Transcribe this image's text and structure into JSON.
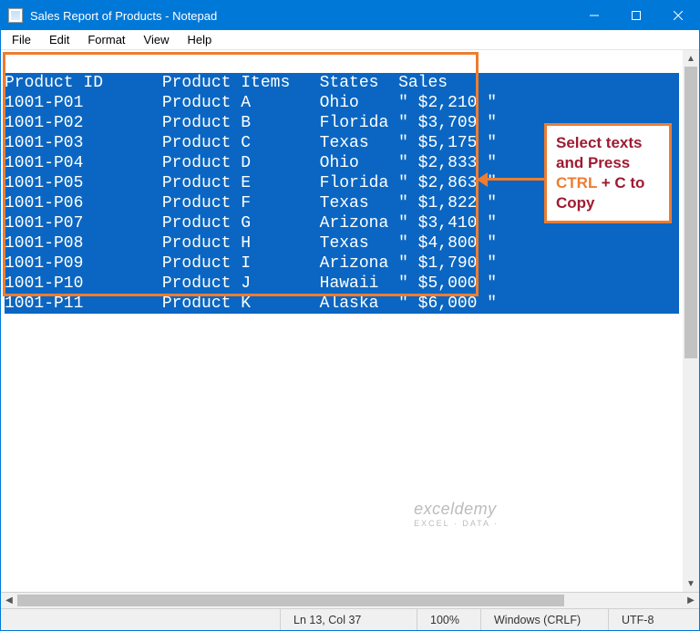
{
  "titlebar": {
    "title": "Sales Report of Products - Notepad"
  },
  "menu": {
    "items": [
      "File",
      "Edit",
      "Format",
      "View",
      "Help"
    ]
  },
  "headers": "Product ID      Product Items   States  Sales",
  "rows": [
    "1001-P01        Product A       Ohio    \" $2,210 \"",
    "1001-P02        Product B       Florida \" $3,709 \"",
    "1001-P03        Product C       Texas   \" $5,175 \"",
    "1001-P04        Product D       Ohio    \" $2,833 \"",
    "1001-P05        Product E       Florida \" $2,863 \"",
    "1001-P06        Product F       Texas   \" $1,822 \"",
    "1001-P07        Product G       Arizona \" $3,410 \"",
    "1001-P08        Product H       Texas   \" $4,800 \"",
    "1001-P09        Product I       Arizona \" $1,790 \"",
    "1001-P10        Product J       Hawaii  \" $5,000 \"",
    "1001-P11        Product K       Alaska  \" $6,000 \""
  ],
  "callout": {
    "line1": "Select texts",
    "line2": "and Press",
    "ctrl": "CTRL",
    "plus": " + C to",
    "line3": "Copy"
  },
  "status": {
    "pos": "Ln 13, Col 37",
    "zoom": "100%",
    "eol": "Windows (CRLF)",
    "enc": "UTF-8"
  },
  "watermark": {
    "main": "exceldemy",
    "sub": "EXCEL · DATA · "
  }
}
